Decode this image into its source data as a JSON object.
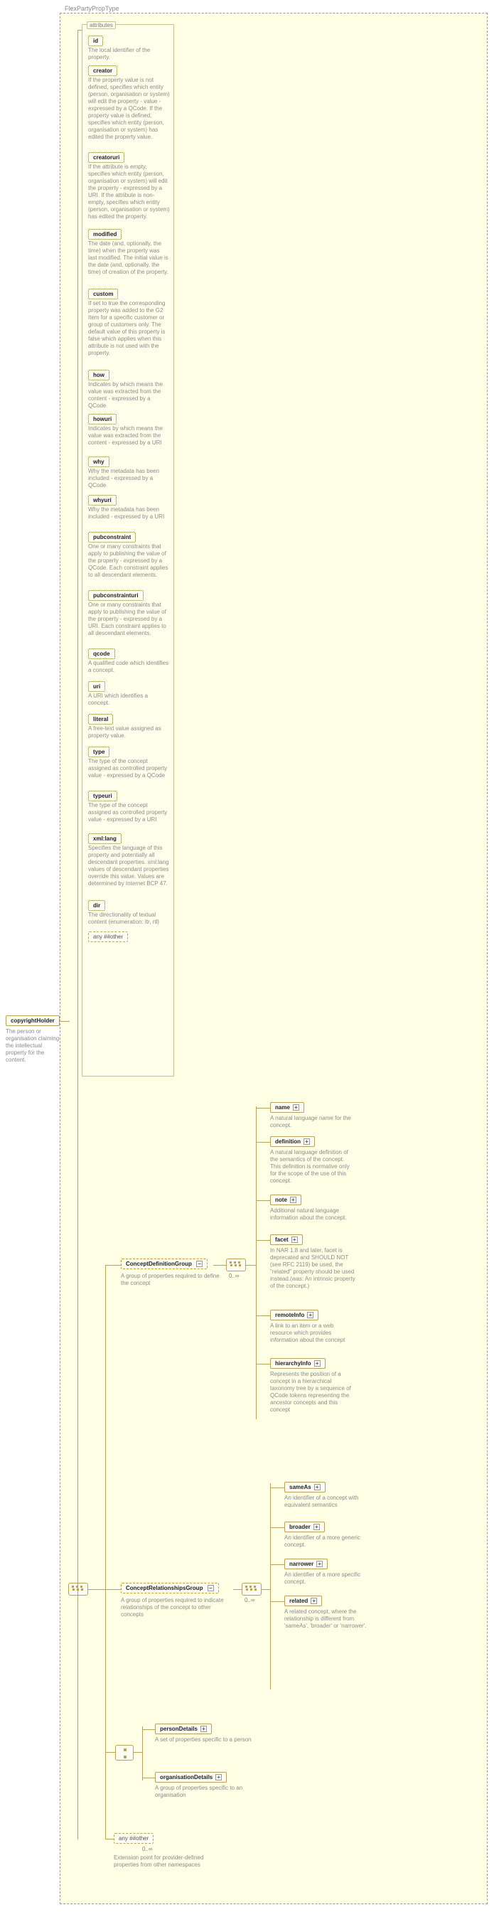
{
  "type_name": "FlexPartyPropType",
  "root": {
    "name": "copyrightHolder",
    "desc": "The person or organisation claiming the intellectual property for the content."
  },
  "attributes_label": "attributes",
  "attributes": [
    {
      "name": "id",
      "desc": "The local identifier of the property."
    },
    {
      "name": "creator",
      "desc": "If the property value is not defined, specifies which entity (person, organisation or system) will edit the property - value - expressed by a QCode. If the property value is defined, specifies which entity (person, organisation or system) has edited the property value."
    },
    {
      "name": "creatoruri",
      "desc": "If the attribute is empty, specifies which entity (person, organisation or system) will edit the property - expressed by a URI. If the attribute is non-empty, specifies which entity (person, organisation or system) has edited the property."
    },
    {
      "name": "modified",
      "desc": "The date (and, optionally, the time) when the property was last modified. The initial value is the date (and, optionally, the time) of creation of the property."
    },
    {
      "name": "custom",
      "desc": "If set to true the corresponding property was added to the G2 Item for a specific customer or group of customers only. The default value of this property is false which applies when this attribute is not used with the property."
    },
    {
      "name": "how",
      "desc": "Indicates by which means the value was extracted from the content - expressed by a QCode"
    },
    {
      "name": "howuri",
      "desc": "Indicates by which means the value was extracted from the content - expressed by a URI"
    },
    {
      "name": "why",
      "desc": "Why the metadata has been included - expressed by a QCode"
    },
    {
      "name": "whyuri",
      "desc": "Why the metadata has been included - expressed by a URI"
    },
    {
      "name": "pubconstraint",
      "desc": "One or many constraints that apply to publishing the value of the property - expressed by a QCode. Each constraint applies to all descendant elements."
    },
    {
      "name": "pubconstrainturi",
      "desc": "One or many constraints that apply to publishing the value of the property - expressed by a URI. Each constraint applies to all descendant elements."
    },
    {
      "name": "qcode",
      "desc": "A qualified code which identifies a concept."
    },
    {
      "name": "uri",
      "desc": "A URI which identifies a concept."
    },
    {
      "name": "literal",
      "desc": "A free-text value assigned as property value."
    },
    {
      "name": "type",
      "desc": "The type of the concept assigned as controlled property value - expressed by a QCode"
    },
    {
      "name": "typeuri",
      "desc": "The type of the concept assigned as controlled property value - expressed by a URI"
    },
    {
      "name": "xml:lang",
      "desc": "Specifies the language of this property and potentially all descendant properties. xml:lang values of descendant properties override this value. Values are determined by Internet BCP 47."
    },
    {
      "name": "dir",
      "desc": "The directionality of textual content (enumeration: ltr, rtl)"
    }
  ],
  "any_other_label": "any ##other",
  "groups": {
    "cdg": {
      "name": "ConceptDefinitionGroup",
      "desc": "A group of properties required to define the concept",
      "occur": "0..∞"
    },
    "crg": {
      "name": "ConceptRelationshipsGroup",
      "desc": "A group of properties required to indicate relationships of the concept to other concepts",
      "occur": "0..∞"
    }
  },
  "cdg_children": [
    {
      "name": "name",
      "desc": "A natural language name for the concept."
    },
    {
      "name": "definition",
      "desc": "A natural language definition of the semantics of the concept. This definition is normative only for the scope of the use of this concept."
    },
    {
      "name": "note",
      "desc": "Additional natural language information about the concept."
    },
    {
      "name": "facet",
      "desc": "In NAR 1.8 and later, facet is deprecated and SHOULD NOT (see RFC 2119) be used, the \"related\" property should be used instead.(was: An intrinsic property of the concept.)"
    },
    {
      "name": "remoteInfo",
      "desc": "A link to an item or a web resource which provides information about the concept"
    },
    {
      "name": "hierarchyInfo",
      "desc": "Represents the position of a concept in a hierarchical taxonomy tree by a sequence of QCode tokens representing the ancestor concepts and this concept"
    }
  ],
  "crg_children": [
    {
      "name": "sameAs",
      "desc": "An identifier of a concept with equivalent semantics"
    },
    {
      "name": "broader",
      "desc": "An identifier of a more generic concept."
    },
    {
      "name": "narrower",
      "desc": "An identifier of a more specific concept."
    },
    {
      "name": "related",
      "desc": "A related concept, where the relationship is different from 'sameAs', 'broader' or 'narrower'."
    }
  ],
  "choice_children": [
    {
      "name": "personDetails",
      "desc": "A set of properties specific to a person"
    },
    {
      "name": "organisationDetails",
      "desc": "A group of properties specific to an organisation"
    }
  ],
  "bottom_any": {
    "label": "any ##other",
    "occur": "0..∞",
    "desc": "Extension point for provider-defined properties from other namespaces"
  }
}
